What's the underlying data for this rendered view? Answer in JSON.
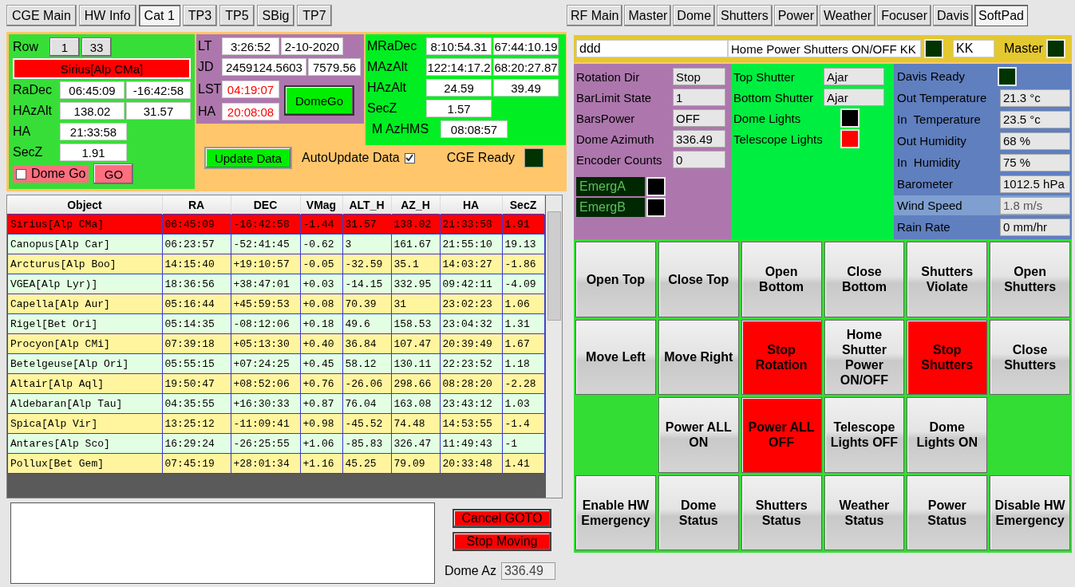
{
  "left_tabs": [
    {
      "label": "CGE Main",
      "selected": false
    },
    {
      "label": "HW Info",
      "selected": false
    },
    {
      "label": "Cat 1",
      "selected": true
    },
    {
      "label": "TP3",
      "selected": false
    },
    {
      "label": "TP5",
      "selected": false
    },
    {
      "label": "SBig",
      "selected": false
    },
    {
      "label": "TP7",
      "selected": false
    }
  ],
  "right_tabs": [
    {
      "label": "RF Main",
      "selected": false
    },
    {
      "label": "Master",
      "selected": false
    },
    {
      "label": "Dome",
      "selected": false
    },
    {
      "label": "Shutters",
      "selected": false
    },
    {
      "label": "Power",
      "selected": false
    },
    {
      "label": "Weather",
      "selected": false
    },
    {
      "label": "Focuser",
      "selected": false
    },
    {
      "label": "Davis",
      "selected": false
    },
    {
      "label": "SoftPad",
      "selected": true
    }
  ],
  "target": {
    "row_label": "Row",
    "row_buttons": [
      "1",
      "33"
    ],
    "name": "Sirius[Alp CMa]",
    "fields": [
      {
        "label": "RaDec",
        "values": [
          "06:45:09",
          "-16:42:58"
        ]
      },
      {
        "label": "HAzAlt",
        "values": [
          "138.02",
          "31.57"
        ]
      },
      {
        "label": "HA",
        "values": [
          "21:33:58"
        ]
      },
      {
        "label": "SecZ",
        "values": [
          "1.91"
        ]
      }
    ],
    "dome_go": {
      "label": "Dome Go",
      "checked": false
    },
    "go_button": "GO"
  },
  "time": {
    "fields": [
      {
        "label": "LT",
        "values": [
          "3:26:52",
          "2-10-2020"
        ],
        "alert": false
      },
      {
        "label": "JD",
        "values": [
          "2459124.5603",
          "7579.56"
        ],
        "alert": false
      },
      {
        "label": "LST",
        "values": [
          "04:19:07"
        ],
        "alert": true
      },
      {
        "label": "HA",
        "values": [
          "20:08:08"
        ],
        "alert": true
      }
    ],
    "dome_go_button": "DomeGo"
  },
  "mount": {
    "fields": [
      {
        "label": "MRaDec",
        "values": [
          "8:10:54.31",
          "67:44:10.19"
        ]
      },
      {
        "label": "MAzAlt",
        "values": [
          "122:14:17.2",
          "68:20:27.87"
        ]
      },
      {
        "label": "HAzAlt",
        "values": [
          "24.59",
          "39.49"
        ]
      },
      {
        "label": "SecZ",
        "values": [
          "1.57"
        ]
      }
    ],
    "hms": {
      "label": "M AzHMS",
      "value": "08:08:57"
    }
  },
  "update_button": "Update Data",
  "auto_update": {
    "label": "AutoUpdate Data",
    "checked": true
  },
  "cge_ready": {
    "label": "CGE Ready",
    "color": "#003300"
  },
  "catalog": {
    "columns": [
      "Object",
      "RA",
      "DEC",
      "VMag",
      "ALT_H",
      "AZ_H",
      "HA",
      "SecZ"
    ],
    "rows": [
      {
        "cells": [
          "Sirius[Alp CMa]",
          "06:45:09",
          "-16:42:58",
          "-1.44",
          "31.57",
          "138.02",
          "21:33:58",
          "1.91"
        ],
        "selected": true
      },
      {
        "cells": [
          "Canopus[Alp Car]",
          "06:23:57",
          "-52:41:45",
          "-0.62",
          "3",
          "161.67",
          "21:55:10",
          "19.13"
        ],
        "selected": false
      },
      {
        "cells": [
          "Arcturus[Alp Boo]",
          "14:15:40",
          "+19:10:57",
          "-0.05",
          "-32.59",
          "35.1",
          "14:03:27",
          "-1.86"
        ],
        "selected": false
      },
      {
        "cells": [
          "VGEA[Alp Lyr)]",
          "18:36:56",
          "+38:47:01",
          "+0.03",
          "-14.15",
          "332.95",
          "09:42:11",
          "-4.09"
        ],
        "selected": false
      },
      {
        "cells": [
          "Capella[Alp Aur]",
          "05:16:44",
          "+45:59:53",
          "+0.08",
          "70.39",
          "31",
          "23:02:23",
          "1.06"
        ],
        "selected": false
      },
      {
        "cells": [
          "Rigel[Bet Ori]",
          "05:14:35",
          "-08:12:06",
          "+0.18",
          "49.6",
          "158.53",
          "23:04:32",
          "1.31"
        ],
        "selected": false
      },
      {
        "cells": [
          "Procyon[Alp CMi]",
          "07:39:18",
          "+05:13:30",
          "+0.40",
          "36.84",
          "107.47",
          "20:39:49",
          "1.67"
        ],
        "selected": false
      },
      {
        "cells": [
          "Betelgeuse[Alp Ori]",
          "05:55:15",
          "+07:24:25",
          "+0.45",
          "58.12",
          "130.11",
          "22:23:52",
          "1.18"
        ],
        "selected": false
      },
      {
        "cells": [
          "Altair[Alp Aql]",
          "19:50:47",
          "+08:52:06",
          "+0.76",
          "-26.06",
          "298.66",
          "08:28:20",
          "-2.28"
        ],
        "selected": false
      },
      {
        "cells": [
          "Aldebaran[Alp Tau]",
          "04:35:55",
          "+16:30:33",
          "+0.87",
          "76.04",
          "163.08",
          "23:43:12",
          "1.03"
        ],
        "selected": false
      },
      {
        "cells": [
          "Spica[Alp Vir]",
          "13:25:12",
          "-11:09:41",
          "+0.98",
          "-45.52",
          "74.48",
          "14:53:55",
          "-1.4"
        ],
        "selected": false
      },
      {
        "cells": [
          "Antares[Alp Sco]",
          "16:29:24",
          "-26:25:55",
          "+1.06",
          "-85.83",
          "326.47",
          "11:49:43",
          "-1"
        ],
        "selected": false
      },
      {
        "cells": [
          "Pollux[Bet Gem]",
          "07:45:19",
          "+28:01:34",
          "+1.16",
          "45.25",
          "79.09",
          "20:33:48",
          "1.41"
        ],
        "selected": false
      }
    ]
  },
  "cancel_button": "Cancel GOTO",
  "stop_button": "Stop Moving",
  "dome_az": {
    "label": "Dome Az",
    "value": "336.49"
  },
  "command": {
    "name": "ddd",
    "text": "Home Power Shutters ON/OFF KK",
    "indicator": {
      "color": "#003300"
    },
    "code": "KK",
    "master": {
      "label": "Master",
      "color": "#003300"
    }
  },
  "dome": {
    "fields": [
      {
        "label": "Rotation Dir",
        "value": "Stop"
      },
      {
        "label": "BarLimit State",
        "value": "1"
      },
      {
        "label": "BarsPower",
        "value": "OFF"
      },
      {
        "label": "Dome Azimuth",
        "value": "336.49"
      },
      {
        "label": "Encoder Counts",
        "value": "0"
      }
    ],
    "emergency": [
      {
        "label": "EmergA",
        "color": "#000000"
      },
      {
        "label": "EmergB",
        "color": "#000000"
      }
    ]
  },
  "shutters": {
    "items": [
      {
        "kind": "text",
        "label": "Top Shutter",
        "value": "Ajar"
      },
      {
        "kind": "text",
        "label": "Bottom Shutter",
        "value": "Ajar"
      },
      {
        "kind": "light",
        "label": "Dome Lights",
        "color": "#000000"
      },
      {
        "kind": "light",
        "label": "Telescope Lights",
        "color": "#ff0000"
      }
    ]
  },
  "weather": {
    "ready": {
      "label": "Davis Ready",
      "color": "#003300"
    },
    "fields": [
      {
        "label": "Out Temperature",
        "value": "21.3 °c",
        "selected": false
      },
      {
        "label": "In  Temperature",
        "value": "23.5 °c",
        "selected": false
      },
      {
        "label": "Out Humidity",
        "value": "68 %",
        "selected": false
      },
      {
        "label": "In  Humidity",
        "value": "75 %",
        "selected": false
      },
      {
        "label": "Barometer",
        "value": "1012.5 hPa",
        "selected": false
      },
      {
        "label": "Wind Speed",
        "value": "1.8 m/s",
        "selected": true
      },
      {
        "label": "Rain Rate",
        "value": "0 mm/hr",
        "selected": false
      }
    ]
  },
  "pad": [
    {
      "kind": "button",
      "label": "Open Top",
      "on": false
    },
    {
      "kind": "button",
      "label": "Close Top",
      "on": false
    },
    {
      "kind": "button",
      "label": "Open Bottom",
      "on": false
    },
    {
      "kind": "button",
      "label": "Close Bottom",
      "on": false
    },
    {
      "kind": "button",
      "label": "Shutters Violate",
      "on": false
    },
    {
      "kind": "button",
      "label": "Open Shutters",
      "on": false
    },
    {
      "kind": "button",
      "label": "Move Left",
      "on": false
    },
    {
      "kind": "button",
      "label": "Move Right",
      "on": false
    },
    {
      "kind": "button",
      "label": "Stop Rotation",
      "on": true
    },
    {
      "kind": "button",
      "label": "Home Shutter Power ON/OFF",
      "on": false
    },
    {
      "kind": "button",
      "label": "Stop Shutters",
      "on": true
    },
    {
      "kind": "button",
      "label": "Close Shutters",
      "on": false
    },
    {
      "kind": "blank"
    },
    {
      "kind": "button",
      "label": "Power ALL ON",
      "on": false
    },
    {
      "kind": "button",
      "label": "Power ALL OFF",
      "on": true
    },
    {
      "kind": "button",
      "label": "Telescope Lights OFF",
      "on": false
    },
    {
      "kind": "button",
      "label": "Dome Lights ON",
      "on": false
    },
    {
      "kind": "blank"
    },
    {
      "kind": "button",
      "label": "Enable HW Emergency",
      "on": false
    },
    {
      "kind": "button",
      "label": "Dome Status",
      "on": false
    },
    {
      "kind": "button",
      "label": "Shutters Status",
      "on": false
    },
    {
      "kind": "button",
      "label": "Weather Status",
      "on": false
    },
    {
      "kind": "button",
      "label": "Power Status",
      "on": false
    },
    {
      "kind": "button",
      "label": "Disable HW Emergency",
      "on": false
    }
  ]
}
